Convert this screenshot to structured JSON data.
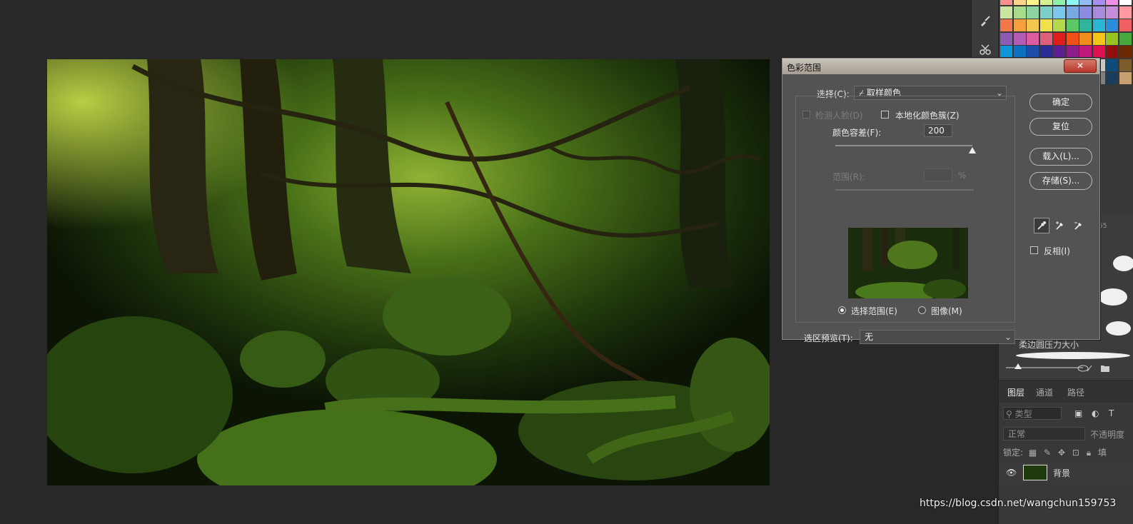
{
  "dialog": {
    "title": "色彩范围",
    "close": "✕",
    "select_label": "选择(C):",
    "select_value": "取样颜色",
    "detect_faces_label": "检测人脸(D)",
    "localized_clusters_label": "本地化颜色簇(Z)",
    "fuzziness_label": "颜色容差(F):",
    "fuzziness_value": "200",
    "fuzziness_level": 1.0,
    "range_label": "范围(R):",
    "range_unit": "%",
    "radio_selection_label": "选择范围(E)",
    "radio_image_label": "图像(M)",
    "selected_radio": "selection",
    "preview_label": "选区预览(T):",
    "preview_value": "无",
    "buttons": {
      "ok": "确定",
      "reset": "复位",
      "load": "载入(L)...",
      "save": "存储(S)..."
    },
    "invert_label": "反相(I)",
    "icons": [
      "eyedropper-icon",
      "eyedropper-plus-icon",
      "eyedropper-minus-icon"
    ]
  },
  "layers_panel": {
    "tabs": [
      "图层",
      "通道",
      "路径"
    ],
    "active_tab": "图层",
    "filter_placeholder": "类型",
    "blend_mode": "正常",
    "opacity_label": "不透明度",
    "lock_label": "锁定:",
    "fill_label": "填",
    "layer_name": "背景"
  },
  "brush_panel": {
    "label": "柔边圆压力大小",
    "size_number": "55"
  },
  "watermark": "https://blog.csdn.net/wangchun159753",
  "colors": {
    "canvas_bg": "#282828",
    "dialog_bg": "#535353",
    "close_red": "#b8352a",
    "foliage": "#3d6b1a"
  }
}
